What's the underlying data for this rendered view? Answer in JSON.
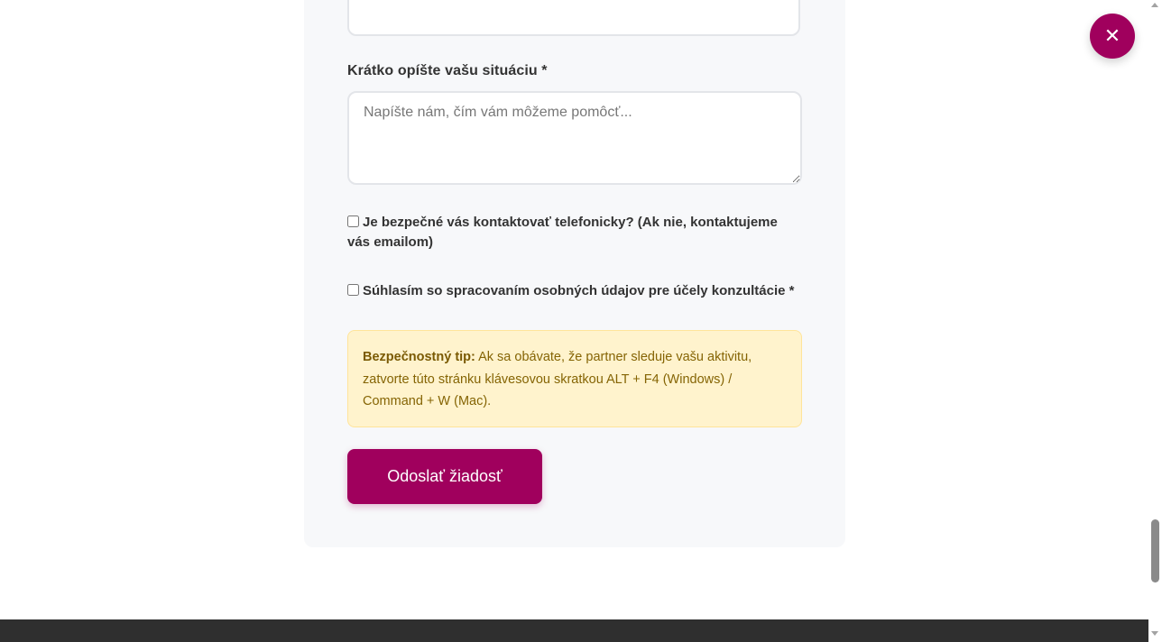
{
  "form": {
    "situation_label": "Krátko opíšte vašu situáciu *",
    "situation_placeholder": "Napíšte nám, čím vám môžeme pomôcť...",
    "situation_value": "",
    "phone_contact_label": "Je bezpečné vás kontaktovať telefonicky? (Ak nie, kontaktujeme vás emailom)",
    "phone_contact_checked": false,
    "consent_label": "Súhlasím so spracovaním osobných údajov pre účely konzultácie *",
    "consent_checked": false,
    "tip_title": "Bezpečnostný tip:",
    "tip_text": " Ak sa obávate, že partner sleduje vašu aktivitu, zatvorte túto stránku klávesovou skratkou ALT + F4 (Windows) / Command + W (Mac).",
    "submit_label": "Odoslať žiadosť"
  },
  "quick_exit": {
    "icon": "close-icon",
    "glyph": "✕"
  },
  "colors": {
    "accent": "#a0005d",
    "tip_background": "#fff3cd",
    "tip_text": "#856404",
    "footer": "#2f2f2f"
  }
}
